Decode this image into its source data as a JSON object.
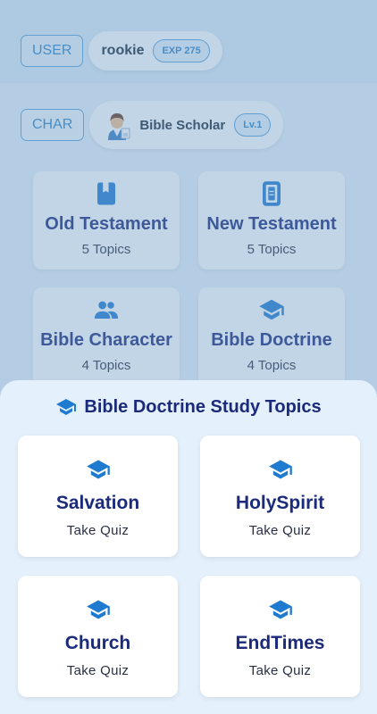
{
  "user": {
    "tag": "USER",
    "name": "rookie",
    "exp": "EXP 275"
  },
  "char": {
    "tag": "CHAR",
    "name": "Bible Scholar",
    "level": "Lv.1",
    "avatar": "scholar-avatar"
  },
  "categories": [
    {
      "title": "Old Testament",
      "subtitle": "5 Topics",
      "icon": "book-icon"
    },
    {
      "title": "New Testament",
      "subtitle": "5 Topics",
      "icon": "tablet-book-icon"
    },
    {
      "title": "Bible Character",
      "subtitle": "4 Topics",
      "icon": "people-icon"
    },
    {
      "title": "Bible Doctrine",
      "subtitle": "4 Topics",
      "icon": "graduation-cap-icon"
    }
  ],
  "sheet": {
    "title": "Bible Doctrine Study Topics",
    "icon": "graduation-cap-icon",
    "topics": [
      {
        "title": "Salvation",
        "action": "Take Quiz"
      },
      {
        "title": "HolySpirit",
        "action": "Take Quiz"
      },
      {
        "title": "Church",
        "action": "Take Quiz"
      },
      {
        "title": "EndTimes",
        "action": "Take Quiz"
      }
    ]
  },
  "colors": {
    "accent": "#2f85c8",
    "title": "#1b2a7a",
    "sheet_bg": "#e4f0fb"
  }
}
